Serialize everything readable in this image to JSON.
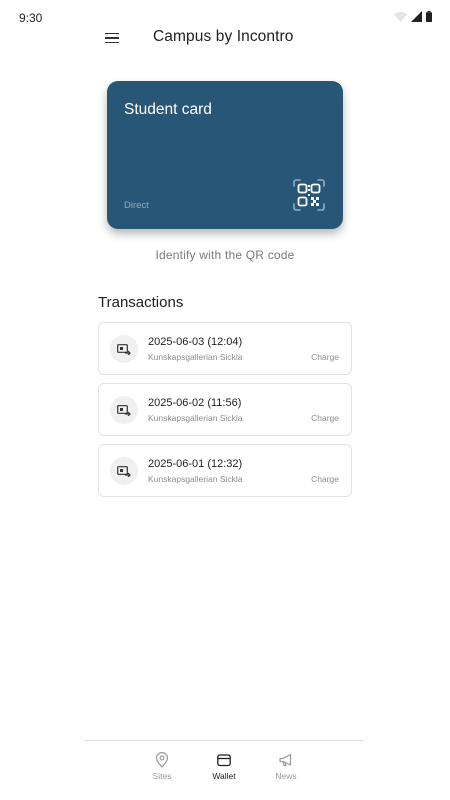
{
  "status_bar": {
    "time": "9:30"
  },
  "app_bar": {
    "title": "Campus by Incontro"
  },
  "card": {
    "title": "Student card",
    "subtitle": "Direct",
    "color": "#285677"
  },
  "qr_caption": "Identify with the QR code",
  "transactions": {
    "title": "Transactions",
    "items": [
      {
        "date": "2025-06-03 (12:04)",
        "place": "Kunskapsgallerian Sickla",
        "type": "Charge"
      },
      {
        "date": "2025-06-02 (11:56)",
        "place": "Kunskapsgallerian Sickla",
        "type": "Charge"
      },
      {
        "date": "2025-06-01 (12:32)",
        "place": "Kunskapsgallerian Sickla",
        "type": "Charge"
      }
    ]
  },
  "bottom_nav": {
    "items": [
      {
        "label": "Sites",
        "icon": "map-pin-icon",
        "active": false
      },
      {
        "label": "Wallet",
        "icon": "wallet-icon",
        "active": true
      },
      {
        "label": "News",
        "icon": "megaphone-icon",
        "active": false
      }
    ]
  }
}
